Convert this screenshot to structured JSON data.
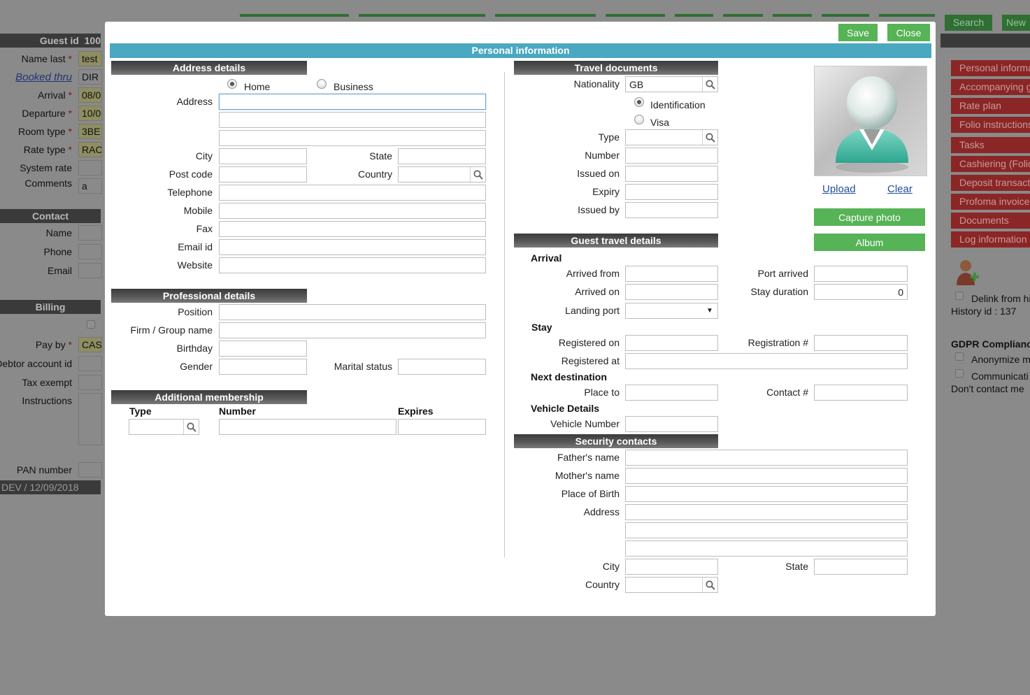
{
  "background": {
    "top_buttons": {
      "search": "Search",
      "new": "New"
    },
    "guest_id_label": "Guest id",
    "guest_id_value": "100",
    "fields": [
      {
        "label": "Name last",
        "required": true,
        "value": "test"
      },
      {
        "label": "Booked thru",
        "link": true,
        "value": "DIR"
      },
      {
        "label": "Arrival",
        "required": true,
        "value": "08/0"
      },
      {
        "label": "Departure",
        "required": true,
        "value": "10/0"
      },
      {
        "label": "Room type",
        "required": true,
        "value": "3BE"
      },
      {
        "label": "Rate type",
        "required": true,
        "value": "RAC"
      },
      {
        "label": "System rate",
        "value": ""
      },
      {
        "label": "Comments",
        "value": "a"
      }
    ],
    "contact_header": "Contact",
    "contact_fields": [
      "Name",
      "Phone",
      "Email"
    ],
    "billing_header": "Billing",
    "billing_fields": [
      {
        "label": "Pay by",
        "required": true,
        "value": "CAS"
      },
      {
        "label": "Debtor account id",
        "value": ""
      },
      {
        "label": "Tax exempt",
        "value": ""
      },
      {
        "label": "Instructions",
        "value": ""
      },
      {
        "label": "PAN number",
        "value": ""
      }
    ],
    "footer": "DEV / 12/09/2018",
    "right_menu": [
      "Personal informa",
      "Accompanying g",
      "Rate plan",
      "Folio instructions",
      "Tasks",
      "Cashiering (Folio",
      "Deposit transacti",
      "Profoma invoice",
      "Documents",
      "Log information"
    ],
    "delink_label": "Delink from hi",
    "history_id": "History id :   137",
    "gdpr_header": "GDPR Complianc",
    "gdpr_options": [
      "Anonymize m",
      "Communicati"
    ],
    "dont_contact": "Don't contact me"
  },
  "modal": {
    "save_label": "Save",
    "close_label": "Close",
    "title": "Personal information",
    "address": {
      "header": "Address details",
      "type_home": "Home",
      "type_business": "Business",
      "address_label": "Address",
      "city_label": "City",
      "state_label": "State",
      "postcode_label": "Post code",
      "country_label": "Country",
      "telephone_label": "Telephone",
      "mobile_label": "Mobile",
      "fax_label": "Fax",
      "email_label": "Email id",
      "website_label": "Website"
    },
    "professional": {
      "header": "Professional details",
      "position_label": "Position",
      "firm_label": "Firm / Group name",
      "birthday_label": "Birthday",
      "gender_label": "Gender",
      "marital_label": "Marital status"
    },
    "membership": {
      "header": "Additional membership",
      "type_label": "Type",
      "number_label": "Number",
      "expires_label": "Expires"
    },
    "travel_docs": {
      "header": "Travel documents",
      "nationality_label": "Nationality",
      "nationality_value": "GB",
      "identification": "Identification",
      "visa": "Visa",
      "type_label": "Type",
      "number_label": "Number",
      "issued_on_label": "Issued on",
      "expiry_label": "Expiry",
      "issued_by_label": "Issued by"
    },
    "photo": {
      "upload": "Upload",
      "clear": "Clear",
      "capture": "Capture photo",
      "album": "Album"
    },
    "guest_travel": {
      "header": "Guest travel details",
      "arrival_title": "Arrival",
      "arrived_from_label": "Arrived from",
      "port_arrived_label": "Port arrived",
      "arrived_on_label": "Arrived on",
      "stay_duration_label": "Stay duration",
      "stay_duration_value": "0",
      "landing_port_label": "Landing port",
      "stay_title": "Stay",
      "registered_on_label": "Registered on",
      "registration_label": "Registration #",
      "registered_at_label": "Registered at",
      "next_dest_title": "Next destination",
      "place_to_label": "Place to",
      "contact_label": "Contact #",
      "vehicle_title": "Vehicle Details",
      "vehicle_number_label": "Vehicle Number"
    },
    "security": {
      "header": "Security contacts",
      "father_label": "Father's name",
      "mother_label": "Mother's name",
      "birthplace_label": "Place of Birth",
      "address_label": "Address",
      "city_label": "City",
      "state_label": "State",
      "country_label": "Country"
    }
  }
}
